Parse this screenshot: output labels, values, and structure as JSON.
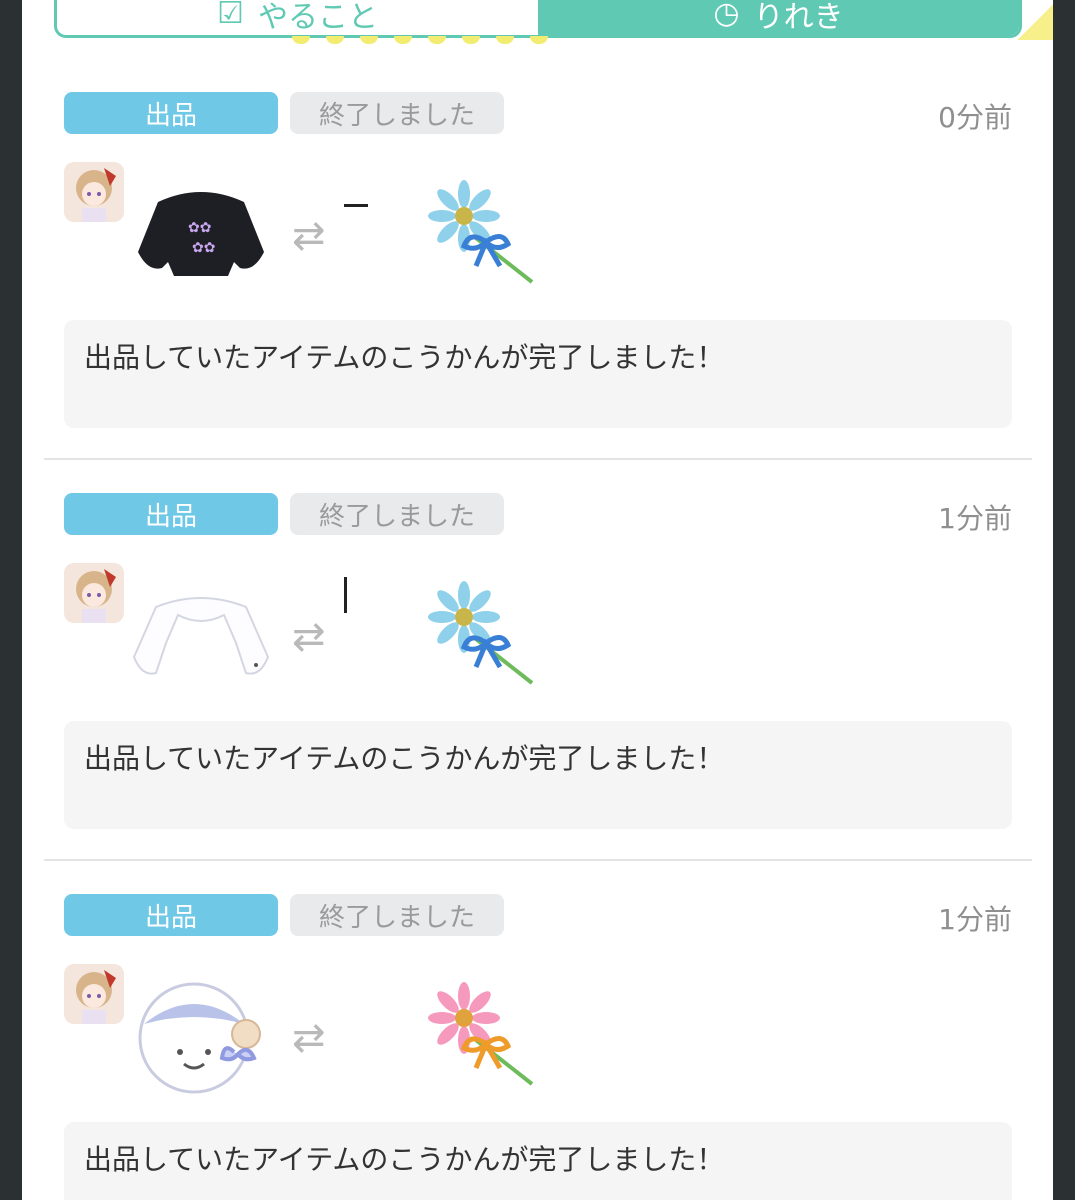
{
  "tabs": [
    {
      "label": "やること",
      "icon": "checkbox-icon",
      "active": false
    },
    {
      "label": "りれき",
      "icon": "clock-icon",
      "active": true
    }
  ],
  "notifications": [
    {
      "type_label": "出品",
      "status_label": "終了しました",
      "time": "0分前",
      "offered_item": "black-sweater-icon",
      "received_item": "blue-daisy-icon",
      "message": "出品していたアイテムのこうかんが完了しました！"
    },
    {
      "type_label": "出品",
      "status_label": "終了しました",
      "time": "1分前",
      "offered_item": "white-bolero-icon",
      "received_item": "blue-daisy-icon",
      "message": "出品していたアイテムのこうかんが完了しました！"
    },
    {
      "type_label": "出品",
      "status_label": "終了しました",
      "time": "1分前",
      "offered_item": "round-hat-icon",
      "received_item": "pink-daisy-icon",
      "message": "出品していたアイテムのこうかんが完了しました！"
    }
  ],
  "colors": {
    "tab_accent": "#5fc9b3",
    "listed_badge": "#6ec8e6",
    "status_badge": "#e9eaec",
    "message_bg": "#f5f5f6"
  }
}
